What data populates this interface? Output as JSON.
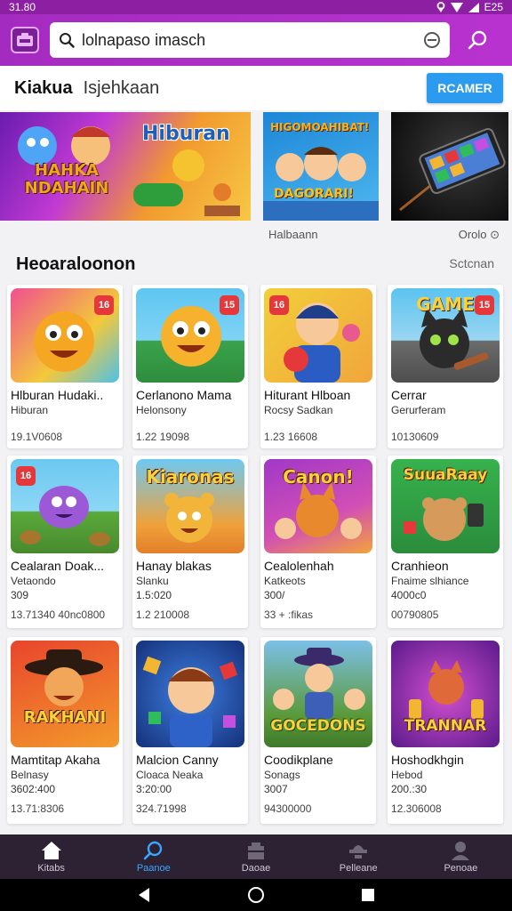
{
  "status_bar": {
    "time": "31.80",
    "right": "E25"
  },
  "search": {
    "value": "lolnapaso imasch"
  },
  "header": {
    "brand": "Kiakua",
    "subtitle": "Isjehkaan",
    "cta_label": "RCAMER"
  },
  "carousel": {
    "banners": [
      {
        "title": "Hiburan",
        "subtitle": "HAHKA NDAHAIN"
      },
      {
        "title": "HIGOMOAHIBAT!",
        "subtitle": "DAGORARI!"
      },
      {
        "title": ""
      }
    ],
    "caption_left": "Halbaann",
    "caption_right": "Orolo ⊙"
  },
  "section": {
    "title": "Heoaraloonon",
    "link": "Sctcnan"
  },
  "games": [
    {
      "title": "Hlburan Hudaki..",
      "sub": "Hiburan",
      "meta": "19.1V0608",
      "badge": "16",
      "thumb_text": ""
    },
    {
      "title": "Cerlanono Mama",
      "sub": "Helonsony",
      "meta": "1.22 19098",
      "badge": "15",
      "thumb_text": ""
    },
    {
      "title": "Hiturant Hlboan",
      "sub": "Rocsy Sadkan",
      "meta": "1.23 16608",
      "badge": "16",
      "thumb_text": ""
    },
    {
      "title": "Cerrar",
      "sub": "Gerurferam",
      "meta": "10130609",
      "badge": "15",
      "thumb_text": "GAME"
    },
    {
      "title": "Cealaran Doak...",
      "sub": "Vetaondo",
      "sub2": "309",
      "meta": "13.71340 40nc0800",
      "badge": "16",
      "thumb_text": ""
    },
    {
      "title": "Hanay blakas",
      "sub": "Slanku",
      "sub2": "1.5:020",
      "meta": "1.2 210008",
      "badge": "",
      "thumb_text": "Kiaronas"
    },
    {
      "title": "Cealolenhah",
      "sub": "Katkeots",
      "sub2": "300/",
      "meta": "33 + :fikas",
      "badge": "",
      "thumb_text": "Canon!"
    },
    {
      "title": "Cranhieon",
      "sub": "Fnaime slhiance",
      "sub2": "4000c0",
      "meta": "00790805",
      "badge": "",
      "thumb_text": "SuuaRaay"
    },
    {
      "title": "Mamtitap Akaha",
      "sub": "Belnasy",
      "sub2": "3602:400",
      "meta": "13.71:8306",
      "badge": "",
      "thumb_text": "RAKHANI"
    },
    {
      "title": "Malcion Canny",
      "sub": "Cloaca Neaka",
      "sub2": "3:20:00",
      "meta": "324.71998",
      "badge": "",
      "thumb_text": ""
    },
    {
      "title": "Coodikplane",
      "sub": "Sonags",
      "sub2": "3007",
      "meta": "94300000",
      "badge": "",
      "thumb_text": "GOCEDONS"
    },
    {
      "title": "Hoshodkhgin",
      "sub": "Hebod",
      "sub2": "200.:30",
      "meta": "12.306008",
      "badge": "",
      "thumb_text": "TRANNAR"
    }
  ],
  "bottom_nav": [
    {
      "label": "Kitabs",
      "icon": "home-icon",
      "active": false
    },
    {
      "label": "Paanoe",
      "icon": "search-icon",
      "active": true
    },
    {
      "label": "Daoae",
      "icon": "store-icon",
      "active": false
    },
    {
      "label": "Pelleane",
      "icon": "gamepad-icon",
      "active": false
    },
    {
      "label": "Penoae",
      "icon": "profile-icon",
      "active": false
    }
  ],
  "colors": {
    "app_bar": "#a42bc0",
    "cta": "#2b9bf0",
    "active_nav": "#3aa6ff",
    "nav_bg": "#2c2233"
  }
}
